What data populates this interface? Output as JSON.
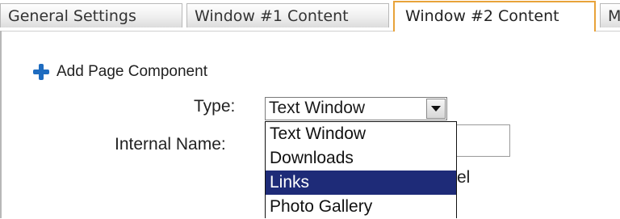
{
  "tabs": [
    {
      "label": "General Settings",
      "active": false
    },
    {
      "label": "Window #1 Content",
      "active": false
    },
    {
      "label": "Window #2 Content",
      "active": true
    },
    {
      "label": "M",
      "active": false
    }
  ],
  "add_component": {
    "label": "Add Page Component",
    "icon": "plus-icon"
  },
  "form": {
    "type_label": "Type:",
    "type_value": "Text Window",
    "internal_name_label": "Internal Name:",
    "internal_name_value": "",
    "partial_text": "el"
  },
  "dropdown": {
    "options": [
      "Text Window",
      "Downloads",
      "Links",
      "Photo Gallery"
    ],
    "highlighted": "Links"
  },
  "colors": {
    "active_tab_border": "#e8a33a",
    "accent_plus": "#1e6cc0",
    "highlight": "#1e2b78"
  }
}
